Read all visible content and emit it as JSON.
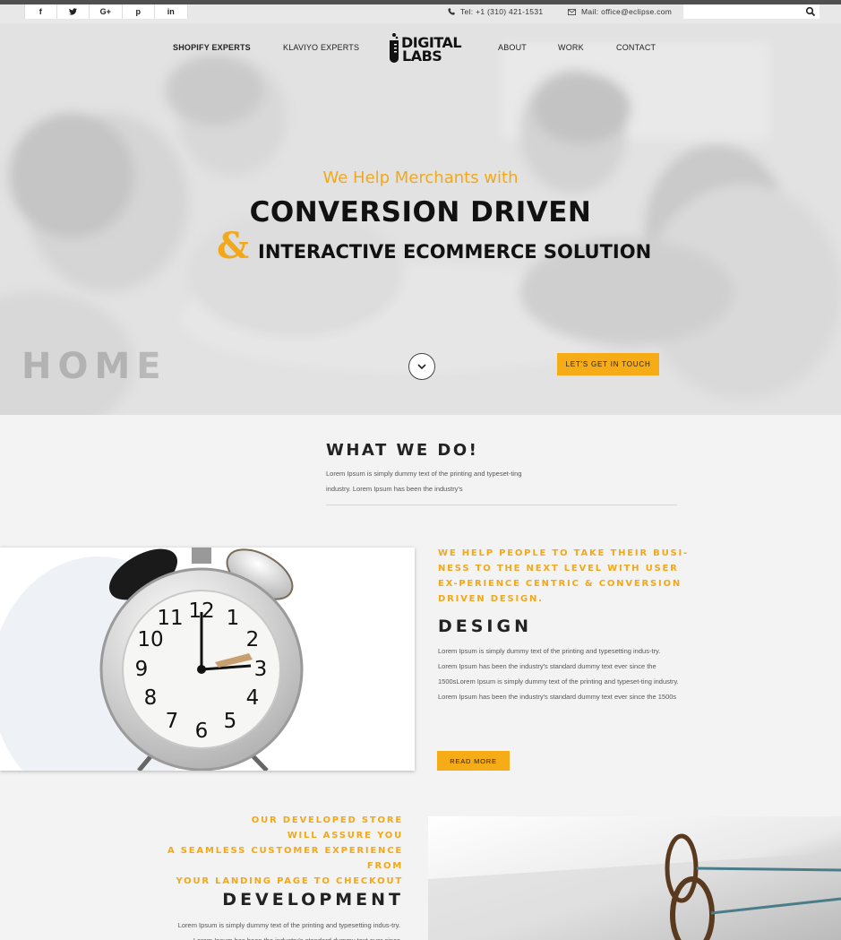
{
  "topbar": {
    "social": [
      {
        "icon": "facebook-icon",
        "glyph": "f"
      },
      {
        "icon": "twitter-icon",
        "glyph": "t"
      },
      {
        "icon": "google-plus-icon",
        "glyph": "G+"
      },
      {
        "icon": "pinterest-icon",
        "glyph": "p"
      },
      {
        "icon": "linkedin-icon",
        "glyph": "in"
      }
    ],
    "phone": "Tel: +1 (310) 421-1531",
    "mail": "Mail: office@eclipse.com",
    "search_placeholder": ""
  },
  "nav": {
    "shopify": "SHOPIFY EXPERTS",
    "klaviyo": "KLAVIYO EXPERTS",
    "logo_line1": "DIGITAL",
    "logo_line2": "LABS",
    "about": "ABOUT",
    "work": "WORK",
    "contact": "CONTACT"
  },
  "hero": {
    "subtitle": "We Help Merchants with",
    "headline": "CONVERSION DRIVEN",
    "ampersand": "&",
    "headline2": "INTERACTIVE ECOMMERCE SOLUTION",
    "watermark": "HOME",
    "cta": "LET'S GET IN TOUCH"
  },
  "what_we_do": {
    "title": "WHAT WE DO!",
    "text": "Lorem Ipsum is simply dummy text of the printing and typeset-ting industry. Lorem Ipsum has been the industry's"
  },
  "design": {
    "tagline": "WE HELP PEOPLE TO TAKE THEIR BUSI-NESS TO THE NEXT LEVEL WITH USER EX-PERIENCE CENTRIC & CONVERSION DRIVEN DESIGN.",
    "heading": "DESIGN",
    "text": "Lorem Ipsum is simply dummy text of the printing and typesetting indus-try. Lorem Ipsum has been the industry's standard dummy text ever since the 1500sLorem Ipsum is simply dummy text of the printing and typeset-ting industry. Lorem Ipsum has been the industry's standard dummy text ever since the 1500s",
    "button": "READ MORE"
  },
  "development": {
    "tagline_lines": [
      "OUR DEVELOPED STORE",
      "WILL ASSURE YOU",
      "A SEAMLESS CUSTOMER EXPERIENCE FROM",
      "YOUR LANDING PAGE TO CHECKOUT"
    ],
    "heading": "DEVELOPMENT",
    "text": "Lorem Ipsum is simply dummy text of the printing and typesetting indus-try. Lorem Ipsum has been the industry's standard dummy text ever since"
  },
  "colors": {
    "accent": "#f2a818",
    "button": "#f5ac16",
    "topstrip": "#505050"
  }
}
